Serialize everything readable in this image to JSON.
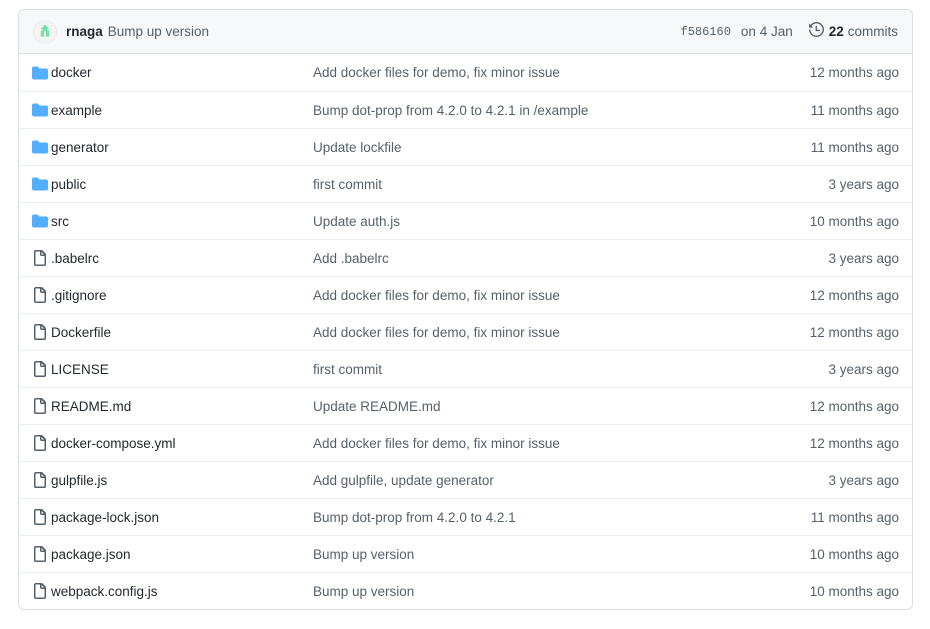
{
  "header": {
    "avatar_icon": "user-avatar-icon",
    "author": "rnaga",
    "commit_message": "Bump up version",
    "commit_sha": "f586160",
    "commit_date": "on 4 Jan",
    "history_icon": "history-icon",
    "commits_count": "22",
    "commits_label": "commits"
  },
  "colors": {
    "folder_blue": "#54aeff",
    "file_gray": "#57606a",
    "avatar_green": "#6ee7b7",
    "header_bg": "#f6f8fa",
    "border": "#d8dee4",
    "row_border": "#eaeef2",
    "text_primary": "#24292f",
    "text_muted": "#57606a"
  },
  "files": [
    {
      "type": "folder",
      "name": "docker",
      "message": "Add docker files for demo, fix minor issue",
      "age": "12 months ago"
    },
    {
      "type": "folder",
      "name": "example",
      "message": "Bump dot-prop from 4.2.0 to 4.2.1 in /example",
      "age": "11 months ago"
    },
    {
      "type": "folder",
      "name": "generator",
      "message": "Update lockfile",
      "age": "11 months ago"
    },
    {
      "type": "folder",
      "name": "public",
      "message": "first commit",
      "age": "3 years ago"
    },
    {
      "type": "folder",
      "name": "src",
      "message": "Update auth.js",
      "age": "10 months ago"
    },
    {
      "type": "file",
      "name": ".babelrc",
      "message": "Add .babelrc",
      "age": "3 years ago"
    },
    {
      "type": "file",
      "name": ".gitignore",
      "message": "Add docker files for demo, fix minor issue",
      "age": "12 months ago"
    },
    {
      "type": "file",
      "name": "Dockerfile",
      "message": "Add docker files for demo, fix minor issue",
      "age": "12 months ago"
    },
    {
      "type": "file",
      "name": "LICENSE",
      "message": "first commit",
      "age": "3 years ago"
    },
    {
      "type": "file",
      "name": "README.md",
      "message": "Update README.md",
      "age": "12 months ago"
    },
    {
      "type": "file",
      "name": "docker-compose.yml",
      "message": "Add docker files for demo, fix minor issue",
      "age": "12 months ago"
    },
    {
      "type": "file",
      "name": "gulpfile.js",
      "message": "Add gulpfile, update generator",
      "age": "3 years ago"
    },
    {
      "type": "file",
      "name": "package-lock.json",
      "message": "Bump dot-prop from 4.2.0 to 4.2.1",
      "age": "11 months ago"
    },
    {
      "type": "file",
      "name": "package.json",
      "message": "Bump up version",
      "age": "10 months ago"
    },
    {
      "type": "file",
      "name": "webpack.config.js",
      "message": "Bump up version",
      "age": "10 months ago"
    }
  ]
}
